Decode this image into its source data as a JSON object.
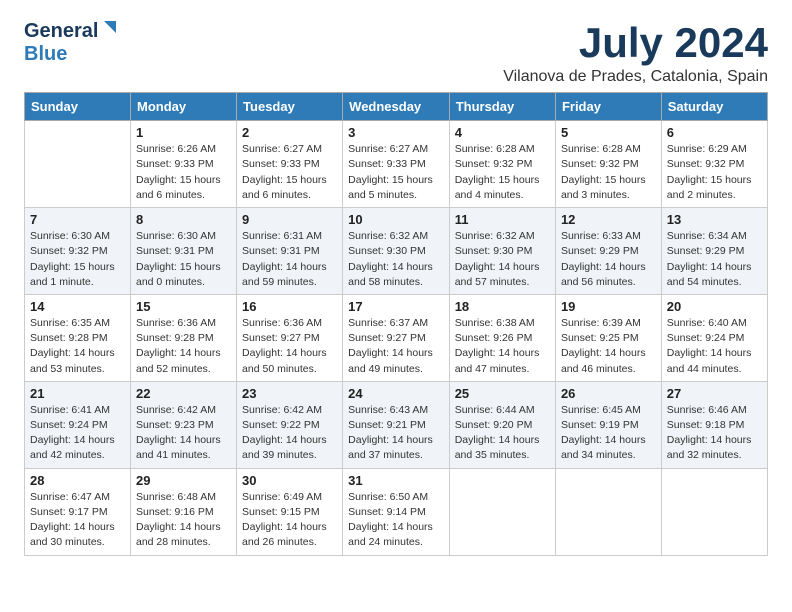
{
  "header": {
    "logo_general": "General",
    "logo_blue": "Blue",
    "main_title": "July 2024",
    "subtitle": "Vilanova de Prades, Catalonia, Spain"
  },
  "days_of_week": [
    "Sunday",
    "Monday",
    "Tuesday",
    "Wednesday",
    "Thursday",
    "Friday",
    "Saturday"
  ],
  "weeks": [
    [
      {
        "day": "",
        "info": ""
      },
      {
        "day": "1",
        "info": "Sunrise: 6:26 AM\nSunset: 9:33 PM\nDaylight: 15 hours\nand 6 minutes."
      },
      {
        "day": "2",
        "info": "Sunrise: 6:27 AM\nSunset: 9:33 PM\nDaylight: 15 hours\nand 6 minutes."
      },
      {
        "day": "3",
        "info": "Sunrise: 6:27 AM\nSunset: 9:33 PM\nDaylight: 15 hours\nand 5 minutes."
      },
      {
        "day": "4",
        "info": "Sunrise: 6:28 AM\nSunset: 9:32 PM\nDaylight: 15 hours\nand 4 minutes."
      },
      {
        "day": "5",
        "info": "Sunrise: 6:28 AM\nSunset: 9:32 PM\nDaylight: 15 hours\nand 3 minutes."
      },
      {
        "day": "6",
        "info": "Sunrise: 6:29 AM\nSunset: 9:32 PM\nDaylight: 15 hours\nand 2 minutes."
      }
    ],
    [
      {
        "day": "7",
        "info": "Sunrise: 6:30 AM\nSunset: 9:32 PM\nDaylight: 15 hours\nand 1 minute."
      },
      {
        "day": "8",
        "info": "Sunrise: 6:30 AM\nSunset: 9:31 PM\nDaylight: 15 hours\nand 0 minutes."
      },
      {
        "day": "9",
        "info": "Sunrise: 6:31 AM\nSunset: 9:31 PM\nDaylight: 14 hours\nand 59 minutes."
      },
      {
        "day": "10",
        "info": "Sunrise: 6:32 AM\nSunset: 9:30 PM\nDaylight: 14 hours\nand 58 minutes."
      },
      {
        "day": "11",
        "info": "Sunrise: 6:32 AM\nSunset: 9:30 PM\nDaylight: 14 hours\nand 57 minutes."
      },
      {
        "day": "12",
        "info": "Sunrise: 6:33 AM\nSunset: 9:29 PM\nDaylight: 14 hours\nand 56 minutes."
      },
      {
        "day": "13",
        "info": "Sunrise: 6:34 AM\nSunset: 9:29 PM\nDaylight: 14 hours\nand 54 minutes."
      }
    ],
    [
      {
        "day": "14",
        "info": "Sunrise: 6:35 AM\nSunset: 9:28 PM\nDaylight: 14 hours\nand 53 minutes."
      },
      {
        "day": "15",
        "info": "Sunrise: 6:36 AM\nSunset: 9:28 PM\nDaylight: 14 hours\nand 52 minutes."
      },
      {
        "day": "16",
        "info": "Sunrise: 6:36 AM\nSunset: 9:27 PM\nDaylight: 14 hours\nand 50 minutes."
      },
      {
        "day": "17",
        "info": "Sunrise: 6:37 AM\nSunset: 9:27 PM\nDaylight: 14 hours\nand 49 minutes."
      },
      {
        "day": "18",
        "info": "Sunrise: 6:38 AM\nSunset: 9:26 PM\nDaylight: 14 hours\nand 47 minutes."
      },
      {
        "day": "19",
        "info": "Sunrise: 6:39 AM\nSunset: 9:25 PM\nDaylight: 14 hours\nand 46 minutes."
      },
      {
        "day": "20",
        "info": "Sunrise: 6:40 AM\nSunset: 9:24 PM\nDaylight: 14 hours\nand 44 minutes."
      }
    ],
    [
      {
        "day": "21",
        "info": "Sunrise: 6:41 AM\nSunset: 9:24 PM\nDaylight: 14 hours\nand 42 minutes."
      },
      {
        "day": "22",
        "info": "Sunrise: 6:42 AM\nSunset: 9:23 PM\nDaylight: 14 hours\nand 41 minutes."
      },
      {
        "day": "23",
        "info": "Sunrise: 6:42 AM\nSunset: 9:22 PM\nDaylight: 14 hours\nand 39 minutes."
      },
      {
        "day": "24",
        "info": "Sunrise: 6:43 AM\nSunset: 9:21 PM\nDaylight: 14 hours\nand 37 minutes."
      },
      {
        "day": "25",
        "info": "Sunrise: 6:44 AM\nSunset: 9:20 PM\nDaylight: 14 hours\nand 35 minutes."
      },
      {
        "day": "26",
        "info": "Sunrise: 6:45 AM\nSunset: 9:19 PM\nDaylight: 14 hours\nand 34 minutes."
      },
      {
        "day": "27",
        "info": "Sunrise: 6:46 AM\nSunset: 9:18 PM\nDaylight: 14 hours\nand 32 minutes."
      }
    ],
    [
      {
        "day": "28",
        "info": "Sunrise: 6:47 AM\nSunset: 9:17 PM\nDaylight: 14 hours\nand 30 minutes."
      },
      {
        "day": "29",
        "info": "Sunrise: 6:48 AM\nSunset: 9:16 PM\nDaylight: 14 hours\nand 28 minutes."
      },
      {
        "day": "30",
        "info": "Sunrise: 6:49 AM\nSunset: 9:15 PM\nDaylight: 14 hours\nand 26 minutes."
      },
      {
        "day": "31",
        "info": "Sunrise: 6:50 AM\nSunset: 9:14 PM\nDaylight: 14 hours\nand 24 minutes."
      },
      {
        "day": "",
        "info": ""
      },
      {
        "day": "",
        "info": ""
      },
      {
        "day": "",
        "info": ""
      }
    ]
  ]
}
